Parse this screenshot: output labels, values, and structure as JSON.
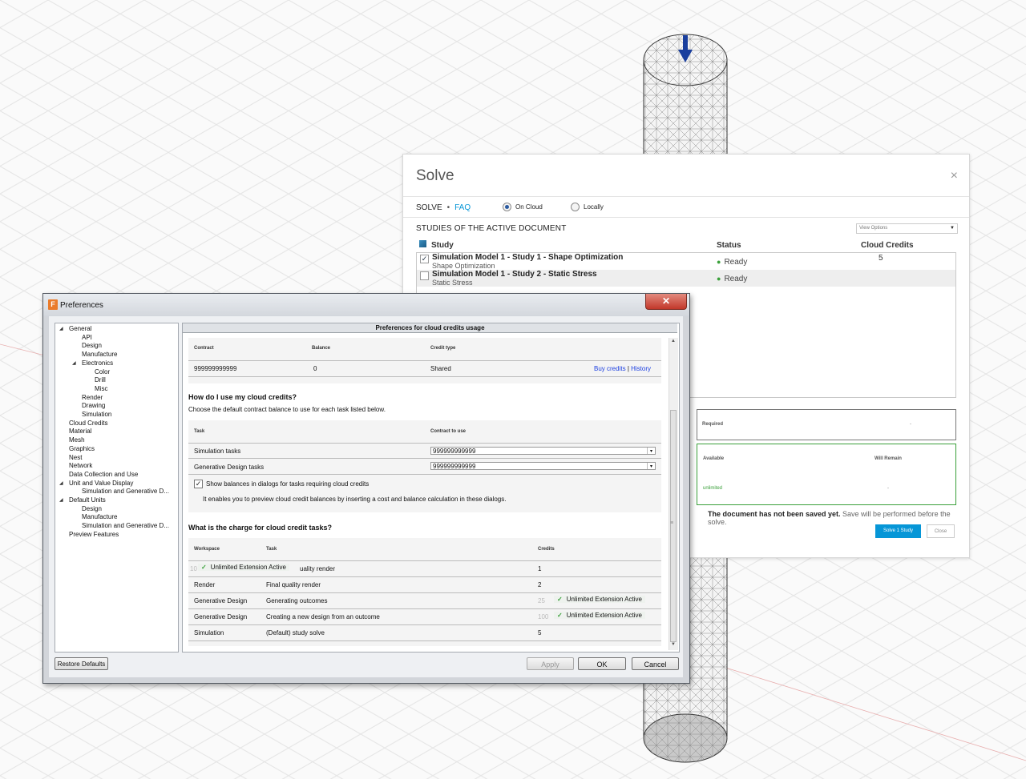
{
  "solve": {
    "title": "Solve",
    "close": "×",
    "tab_solve": "SOLVE",
    "separator": "•",
    "tab_faq": "FAQ",
    "radio_cloud": "On Cloud",
    "radio_local": "Locally",
    "studies_heading": "STUDIES OF THE ACTIVE DOCUMENT",
    "view_options": "View Options",
    "columns": {
      "study": "Study",
      "status": "Status",
      "credits": "Cloud Credits"
    },
    "studies": [
      {
        "name": "Simulation Model 1 - Study 1 - Shape Optimization",
        "type": "Shape Optimization",
        "status": "Ready",
        "credits": "5",
        "checked": "✓"
      },
      {
        "name": "Simulation Model 1 - Study 2 - Static Stress",
        "type": "Static Stress",
        "status": "Ready",
        "credits": "",
        "checked": ""
      }
    ],
    "required_label": "Required",
    "required_value": "-",
    "available_label": "Available",
    "will_remain_label": "Will Remain",
    "available_value": "unlimited",
    "will_remain_value": "-",
    "save_note_bold": "The document has not been saved yet.",
    "save_note": " Save will be performed before the solve.",
    "solve_button": "Solve 1 Study",
    "close_button": "Close"
  },
  "prefs": {
    "title": "Preferences",
    "close": "✕",
    "tree": [
      {
        "label": "General",
        "indent": 0,
        "arrow": "◢"
      },
      {
        "label": "API",
        "indent": 1
      },
      {
        "label": "Design",
        "indent": 1
      },
      {
        "label": "Manufacture",
        "indent": 1
      },
      {
        "label": "Electronics",
        "indent": 1,
        "arrow": "◢"
      },
      {
        "label": "Color",
        "indent": 2
      },
      {
        "label": "Drill",
        "indent": 2
      },
      {
        "label": "Misc",
        "indent": 2
      },
      {
        "label": "Render",
        "indent": 1
      },
      {
        "label": "Drawing",
        "indent": 1
      },
      {
        "label": "Simulation",
        "indent": 1
      },
      {
        "label": "Cloud Credits",
        "indent": 0
      },
      {
        "label": "Material",
        "indent": 0
      },
      {
        "label": "Mesh",
        "indent": 0
      },
      {
        "label": "Graphics",
        "indent": 0
      },
      {
        "label": "Nest",
        "indent": 0
      },
      {
        "label": "Network",
        "indent": 0
      },
      {
        "label": "Data Collection and Use",
        "indent": 0
      },
      {
        "label": "Unit and Value Display",
        "indent": 0,
        "arrow": "◢"
      },
      {
        "label": "Simulation and Generative D...",
        "indent": 1
      },
      {
        "label": "Default Units",
        "indent": 0,
        "arrow": "◢"
      },
      {
        "label": "Design",
        "indent": 1
      },
      {
        "label": "Manufacture",
        "indent": 1
      },
      {
        "label": "Simulation and Generative D...",
        "indent": 1
      },
      {
        "label": "Preview Features",
        "indent": 0
      }
    ],
    "header": "Preferences for cloud credits usage",
    "contract_cols": {
      "contract": "Contract",
      "balance": "Balance",
      "credit_type": "Credit type"
    },
    "contract_row": {
      "contract": "999999999999",
      "balance": "0",
      "credit_type": "Shared",
      "buy": "Buy credits",
      "sep": "|",
      "history": "History"
    },
    "use_heading": "How do I use my cloud credits?",
    "use_desc": "Choose the default contract balance to use for each task listed below.",
    "task_cols": {
      "task": "Task",
      "contract": "Contract to use"
    },
    "tasks": [
      {
        "task": "Simulation tasks",
        "contract": "999999999999"
      },
      {
        "task": "Generative Design tasks",
        "contract": "999999999999"
      }
    ],
    "show_balance_label": "Show balances in dialogs for tasks requiring cloud credits",
    "show_balance_desc": "It enables you to preview cloud credit balances by inserting a cost and balance calculation in these dialogs.",
    "charge_heading": "What is the charge for cloud credit tasks?",
    "charge_cols": {
      "workspace": "Workspace",
      "task": "Task",
      "credits": "Credits"
    },
    "charges": [
      {
        "workspace": "",
        "task": "uality render",
        "credits": "1",
        "overlay": "Unlimited Extension Active",
        "grey": "10"
      },
      {
        "workspace": "Render",
        "task": "Final quality render",
        "credits": "2"
      },
      {
        "workspace": "Generative Design",
        "task": "Generating outcomes",
        "credits": "",
        "overlay": "Unlimited Extension Active",
        "grey": "25"
      },
      {
        "workspace": "Generative Design",
        "task": "Creating a new design from an outcome",
        "credits": "",
        "overlay": "Unlimited Extension Active",
        "grey": "100"
      },
      {
        "workspace": "Simulation",
        "task": "(Default) study solve",
        "credits": "5"
      }
    ],
    "check_mark": "✓",
    "buttons": {
      "restore": "Restore Defaults",
      "apply": "Apply",
      "ok": "OK",
      "cancel": "Cancel"
    }
  }
}
